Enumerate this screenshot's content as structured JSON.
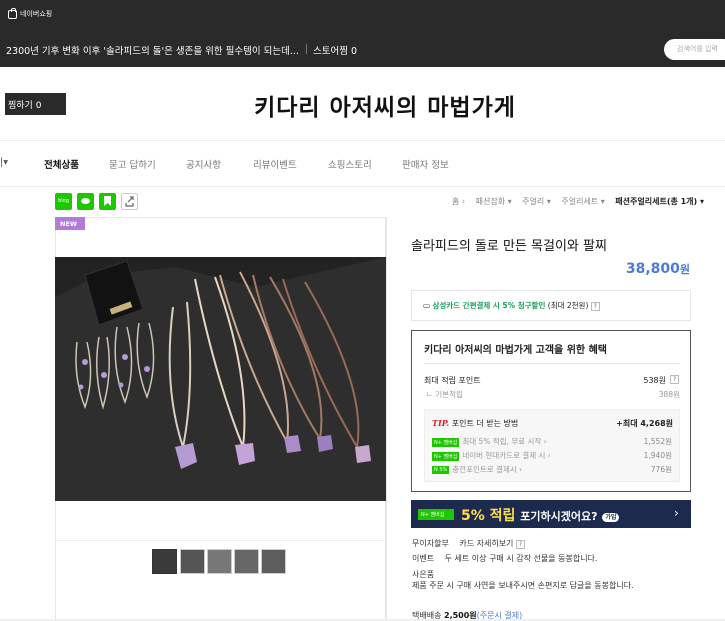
{
  "topbar": {
    "brand": "네이버쇼핑",
    "headline": "2300년 기후 변화 이후 '솔라피드의 돌'은 생존을 위한 필수템이 되는데...",
    "store_zzim": "스토어찜 0",
    "search_placeholder": "검색어를 입력"
  },
  "store": {
    "zzim_button": "찜하기 0",
    "title": "키다리 아저씨의 마법가게"
  },
  "nav": {
    "items": [
      "전체상품",
      "묻고 답하기",
      "공지사항",
      "리뷰이벤트",
      "쇼핑스토리",
      "판매자 정보"
    ]
  },
  "share": {
    "talk_label": "blog"
  },
  "breadcrumb": [
    "홈 ›",
    "패션잡화 ▾",
    "주얼리 ▾",
    "주얼리세트 ▾",
    "패션주얼리세트(총 1개) ▾"
  ],
  "product": {
    "badge": "NEW",
    "name": "솔라피드의 돌로 만든 목걸이와 팔찌",
    "price": "38,800",
    "price_unit": "원"
  },
  "card_offer": {
    "card": "삼성카드 간편결제 시 5% 청구할인",
    "limit": "(최대 2천원)"
  },
  "benefits": {
    "title": "키다리 아저씨의 마법가게 고객을 위한 혜택",
    "max_point_label": "최대 적립 포인트",
    "max_point_value": "538원",
    "base_label": "ㄴ 기본적립",
    "base_value": "388원",
    "tip_word": "TIP.",
    "tip_text": "포인트 더 받는 방법",
    "tip_max": "+최대 4,268원",
    "tip_rows": [
      {
        "badge": "N+ 멤버십",
        "label": "최대 5% 적립, 무료 시작 ›",
        "value": "1,552원"
      },
      {
        "badge": "N+ 멤버십",
        "label": "네이버 현대카드로 결제 시 ›",
        "value": "1,940원"
      },
      {
        "badge": "N 5%",
        "label": "충전포인트로 결제시 ›",
        "value": "776원"
      }
    ]
  },
  "promo": {
    "badge": "N+ 멤버십",
    "highlight": "5% 적립",
    "text": "포기하시겠어요?",
    "tag": "가입"
  },
  "info": {
    "interest_free_label": "무이자할부",
    "interest_free_value": "카드 자세히보기",
    "event_label": "이벤트",
    "event_value": "두 세트 이상 구매 시 감작 선물을 동봉합니다.",
    "gift_label": "사은품",
    "gift_value": "제품 주문 시 구매 사연을 보내주시면 손편지로 답글을 동봉합니다.",
    "shipping_label": "택배배송",
    "shipping_price": "2,500원",
    "shipping_note": "(주문시 결제)"
  },
  "colors": {
    "topbar": "#2a2a2a",
    "price_blue": "#4c7bd4",
    "naver_green": "#1ec800",
    "promo_navy": "#1c2a4e"
  }
}
